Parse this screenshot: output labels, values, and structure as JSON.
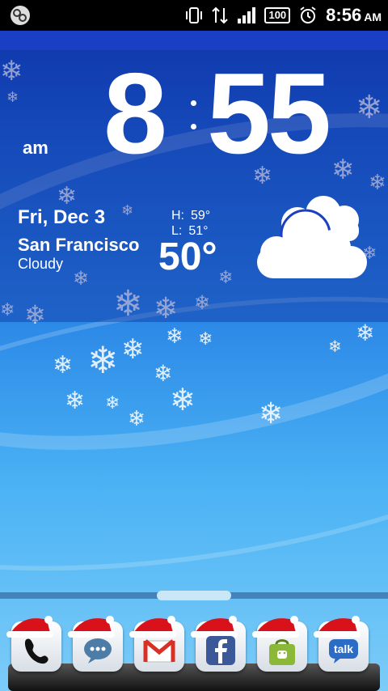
{
  "status_bar": {
    "time": "8:56",
    "ampm": "AM",
    "battery": "100",
    "icons": [
      "messaging-icon",
      "vibrate-icon",
      "data-transfer-icon",
      "signal-icon",
      "battery-icon",
      "alarm-icon"
    ]
  },
  "clock": {
    "hour": "8",
    "minute": "55",
    "ampm": "am"
  },
  "weather": {
    "date": "Fri, Dec 3",
    "city": "San Francisco",
    "condition": "Cloudy",
    "high_label": "H:",
    "high": "59°",
    "low_label": "L:",
    "low": "51°",
    "temperature": "50°",
    "icon": "cloud-icon"
  },
  "dock": {
    "apps": [
      "phone",
      "messaging",
      "gmail",
      "facebook",
      "market",
      "talk"
    ],
    "talk_label": "talk"
  },
  "colors": {
    "accent": "#1b3fc4",
    "wallpaper_top": "#0f3fb8",
    "wallpaper_bottom": "#7cccf8"
  }
}
